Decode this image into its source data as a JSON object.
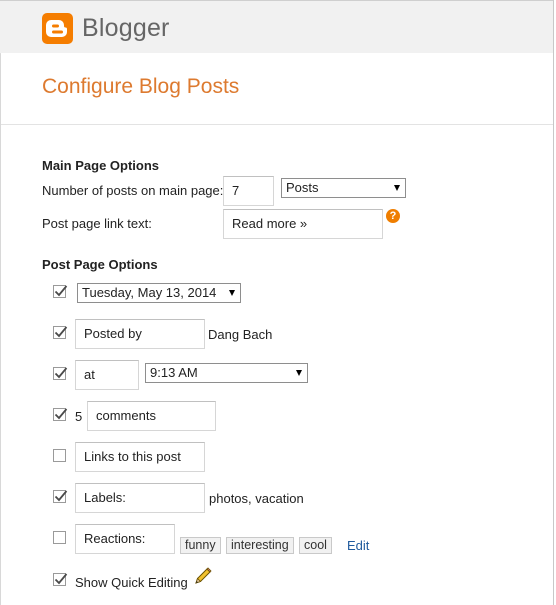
{
  "brand": {
    "name": "Blogger",
    "color": "#f57d00"
  },
  "page_title": "Configure Blog Posts",
  "main_page": {
    "heading": "Main Page Options",
    "posts_label": "Number of posts on main page:",
    "posts_count": "7",
    "posts_unit_selected": "Posts",
    "link_text_label": "Post page link text:",
    "link_text_value": "Read more »",
    "help_icon": "?"
  },
  "post_page": {
    "heading": "Post Page Options",
    "date_format_checked": true,
    "date_format": "Tuesday, May 13, 2014",
    "posted_by_checked": true,
    "posted_by_label": "Posted by",
    "author": "Dang Bach",
    "time_checked": true,
    "time_label": "at",
    "time_format": "9:13 AM",
    "comments_checked": true,
    "comments_count": "5",
    "comments_label": "comments",
    "backlinks_checked": false,
    "backlinks_label": "Links to this post",
    "labels_checked": true,
    "labels_label": "Labels:",
    "labels_example": "photos, vacation",
    "reactions_checked": false,
    "reactions_label": "Reactions:",
    "reactions": [
      "funny",
      "interesting",
      "cool"
    ],
    "reactions_edit": "Edit",
    "quick_edit_checked": true,
    "quick_edit_label": "Show Quick Editing",
    "quick_edit_icon": "pencil-icon"
  },
  "colors": {
    "title": "#dd7a2f",
    "link": "#1f5a9d",
    "help": "#ef7e00"
  }
}
